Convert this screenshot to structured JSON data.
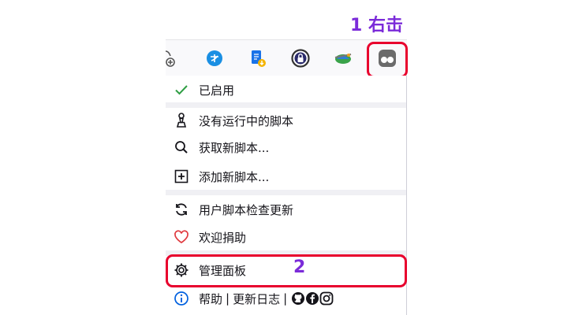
{
  "annotations": {
    "step1": {
      "number": "1",
      "text": "右击"
    },
    "step2": {
      "number": "2"
    }
  },
  "toolbar": {
    "icons": [
      "bookmark-add-icon",
      "translate-icon",
      "download-doc-icon",
      "vpn-lock-icon",
      "earth-icon",
      "tampermonkey-icon"
    ]
  },
  "menu": {
    "enabled": {
      "label": "已启用",
      "icon": "check-icon"
    },
    "no_scripts": {
      "label": "没有运行中的脚本",
      "icon": "chess-pawn-icon"
    },
    "get_scripts": {
      "label": "获取新脚本...",
      "icon": "search-icon"
    },
    "add_script": {
      "label": "添加新脚本...",
      "icon": "plus-square-icon"
    },
    "check_updates": {
      "label": "用户脚本检查更新",
      "icon": "refresh-icon"
    },
    "donate": {
      "label": "欢迎捐助",
      "icon": "heart-icon"
    },
    "dashboard": {
      "label": "管理面板",
      "icon": "gear-icon"
    },
    "footer": {
      "help": "帮助",
      "sep1": "|",
      "changelog": "更新日志",
      "sep2": "|"
    }
  },
  "colors": {
    "annotation_text": "#7b2bd9",
    "annotation_box": "#e8002d",
    "check": "#2f9e44",
    "heart": "#e0393e",
    "info": "#0060df"
  }
}
